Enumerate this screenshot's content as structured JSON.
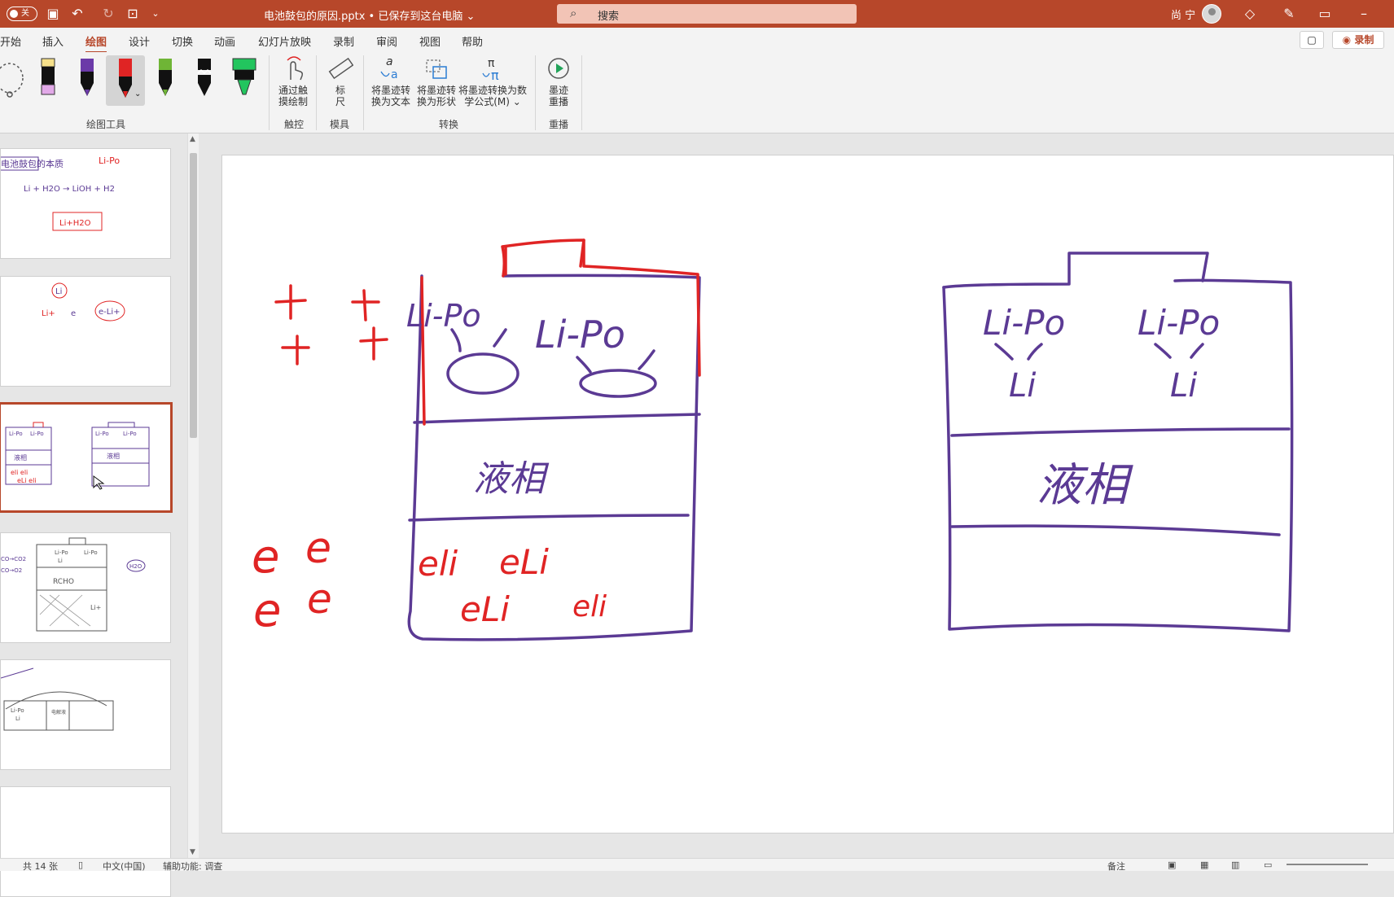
{
  "titlebar": {
    "autosave": "关",
    "doc_title": "电池鼓包的原因.pptx • 已保存到这台电脑",
    "search_placeholder": "搜索",
    "user": "尚 宁"
  },
  "menu": {
    "items": [
      "开始",
      "插入",
      "绘图",
      "设计",
      "切换",
      "动画",
      "幻灯片放映",
      "录制",
      "审阅",
      "视图",
      "帮助"
    ],
    "active": "绘图",
    "record_button": "录制"
  },
  "ribbon": {
    "groups": {
      "draw_tools": "绘图工具",
      "touch": "触控",
      "stencils": "模具",
      "convert": "转换",
      "replay": "重播"
    },
    "buttons": {
      "touch_draw": [
        "通过触",
        "摸绘制"
      ],
      "ruler": [
        "标",
        "尺"
      ],
      "ink_to_text": [
        "将墨迹转",
        "换为文本"
      ],
      "ink_to_shape": [
        "将墨迹转",
        "换为形状"
      ],
      "ink_to_math": [
        "将墨迹转换为数",
        "学公式(M)"
      ],
      "ink_replay": [
        "墨迹",
        "重播"
      ]
    },
    "pens": [
      {
        "name": "highlighter-yellow",
        "color": "#f6e08a"
      },
      {
        "name": "pen-purple",
        "color": "#6b3aa8"
      },
      {
        "name": "pen-red",
        "color": "#e02424"
      },
      {
        "name": "pen-green",
        "color": "#6fb536"
      },
      {
        "name": "pen-black-zigzag",
        "color": "#111111"
      },
      {
        "name": "highlighter-green",
        "color": "#22c55e"
      }
    ]
  },
  "slide": {
    "left_battery": {
      "top_labels": [
        "Li-Po",
        "Li-Po"
      ],
      "middle_label": "液相",
      "bottom_labels": [
        "eli",
        "eLi",
        "eLi",
        "eli"
      ]
    },
    "right_battery": {
      "top_labels": [
        "Li-Po",
        "Li-Po"
      ],
      "sub_labels": [
        "Li",
        "Li"
      ],
      "middle_label": "液相"
    },
    "left_symbols": [
      "+",
      "+",
      "+",
      "+"
    ],
    "left_letters": [
      "e",
      "e",
      "e",
      "e"
    ]
  },
  "thumbnails": [
    {
      "lines": [
        "电池鼓包的本质",
        "Li-Po",
        "Li + H2O → LiOH + H2",
        "Li+H2O"
      ]
    },
    {
      "lines": [
        "Li",
        "Li+",
        "e",
        "e-Li+"
      ]
    },
    {
      "lines": [
        "Li-Po",
        "Li-Po",
        "液相",
        "eli eli",
        "eLi eli",
        "Li-Po",
        "Li-Po",
        "液相"
      ]
    },
    {
      "lines": [
        "CO→CO2",
        "CO→O2",
        "Li-Po",
        "Li",
        "Li-Po",
        "RCHO",
        "Li+",
        "H2O"
      ]
    },
    {
      "lines": [
        "Li-Po",
        "Li",
        "电解液"
      ]
    },
    {
      "lines": []
    }
  ],
  "status": {
    "slide_count": "共 14 张",
    "language": "中文(中国)",
    "accessibility": "辅助功能: 调查",
    "notes": "备注"
  },
  "colors": {
    "accent": "#b7472a",
    "ink_purple": "#5b3a94",
    "ink_red": "#e02424"
  }
}
